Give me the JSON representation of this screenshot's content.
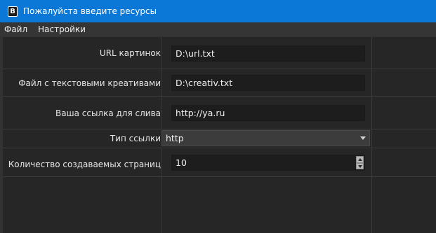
{
  "window": {
    "title": "Пожалуйста введите ресурсы",
    "icon": "app-b-icon",
    "icon_glyph": "B"
  },
  "menu": [
    "Файл",
    "Настройки"
  ],
  "form": {
    "url_label": "URL картинок",
    "url_value": "D:\\url.txt",
    "creatives_label": "Файл с текстовыми креативами",
    "creatives_value": "D:\\creativ.txt",
    "link_label": "Ваша ссылка для слива",
    "link_value": "http://ya.ru",
    "link_type_label": "Тип ссылки",
    "link_type_value": "http",
    "pages_label": "Количество создаваемых страниц",
    "pages_value": "10"
  },
  "colors": {
    "titlebar": "#0b78d7",
    "background": "#262626",
    "field": "#1d1d1d"
  }
}
